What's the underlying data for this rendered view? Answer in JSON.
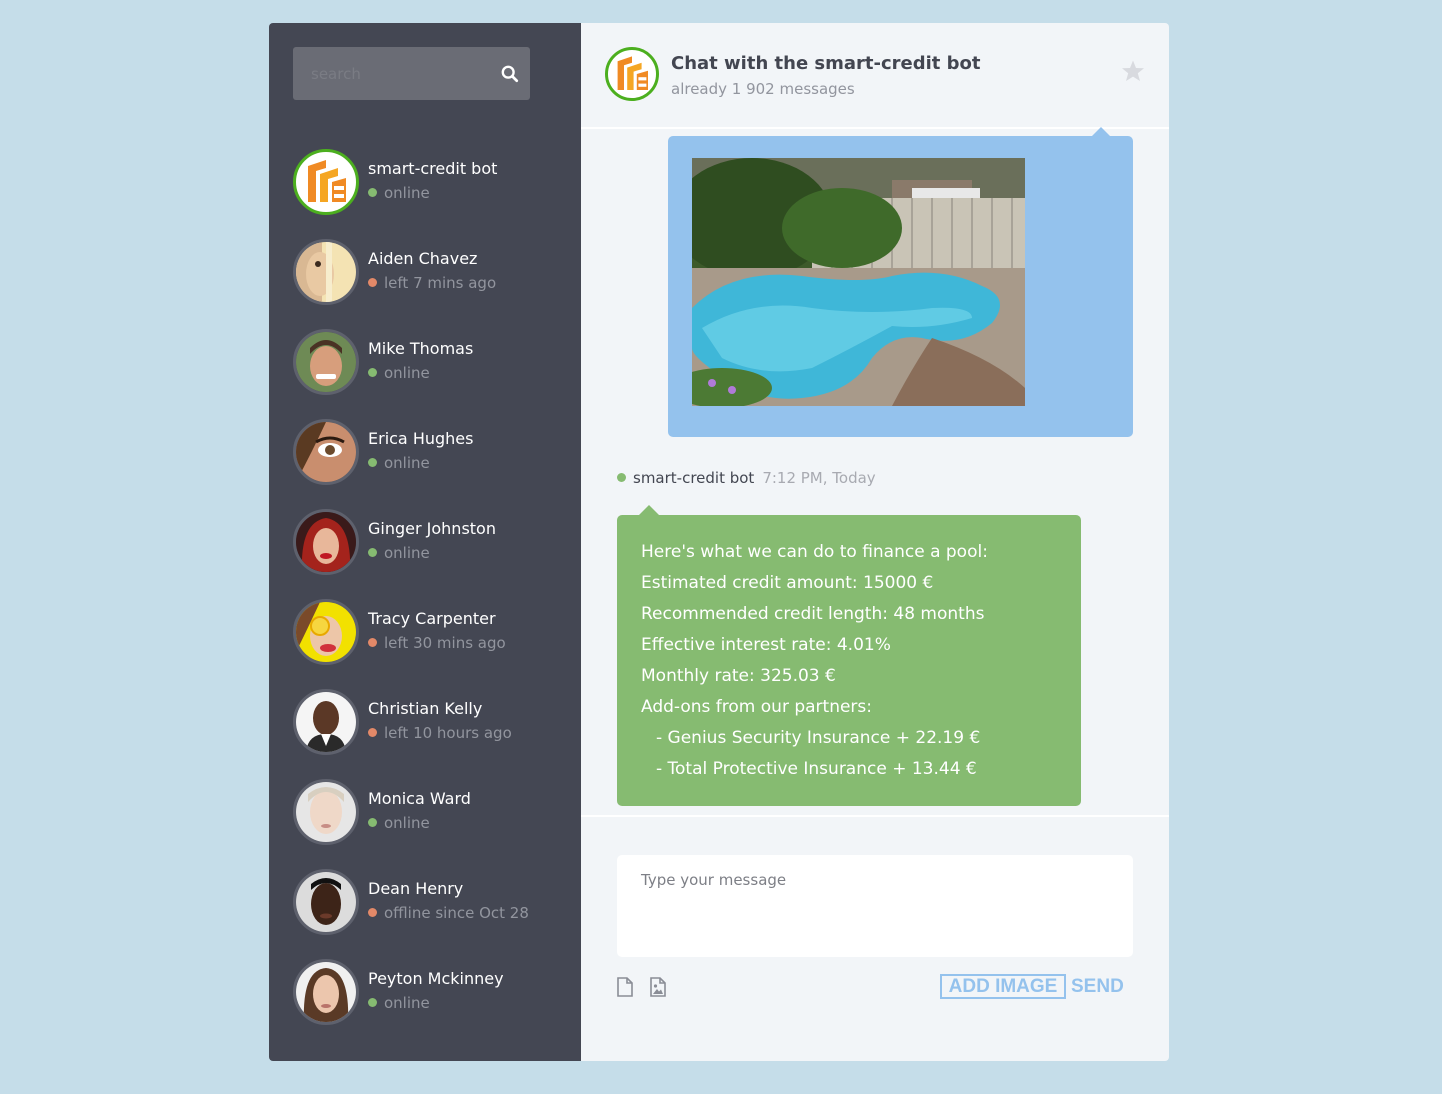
{
  "search": {
    "placeholder": "search",
    "icon": "search-icon"
  },
  "contacts": [
    {
      "name": "smart-credit bot",
      "status": "online",
      "state": "online",
      "avatar": "bot-logo"
    },
    {
      "name": "Aiden Chavez",
      "status": "left 7 mins ago",
      "state": "away",
      "avatar": "photo"
    },
    {
      "name": "Mike Thomas",
      "status": "online",
      "state": "online",
      "avatar": "photo"
    },
    {
      "name": "Erica Hughes",
      "status": "online",
      "state": "online",
      "avatar": "photo"
    },
    {
      "name": "Ginger Johnston",
      "status": "online",
      "state": "online",
      "avatar": "photo"
    },
    {
      "name": "Tracy Carpenter",
      "status": "left 30 mins ago",
      "state": "away",
      "avatar": "photo"
    },
    {
      "name": "Christian Kelly",
      "status": "left 10 hours ago",
      "state": "away",
      "avatar": "photo"
    },
    {
      "name": "Monica Ward",
      "status": "online",
      "state": "online",
      "avatar": "photo"
    },
    {
      "name": "Dean Henry",
      "status": "offline since Oct 28",
      "state": "away",
      "avatar": "photo"
    },
    {
      "name": "Peyton Mckinney",
      "status": "online",
      "state": "online",
      "avatar": "photo"
    }
  ],
  "chat": {
    "title": "Chat with the smart-credit bot",
    "subtitle": "already 1 902 messages",
    "star_icon": "star-icon"
  },
  "messages": {
    "image_message": {
      "content": "swimming-pool-photo"
    },
    "bot_message": {
      "sender": "smart-credit bot",
      "time": "7:12 PM, Today",
      "lines": [
        "Here's what we can do to finance a pool:",
        "Estimated credit amount: 15000 €",
        "Recommended credit length: 48 months",
        "Effective interest rate: 4.01%",
        "Monthly rate: 325.03 €",
        "Add-ons from our partners:",
        "- Genius Security Insurance + 22.19 €",
        "- Total Protective Insurance + 13.44 €"
      ]
    }
  },
  "composer": {
    "placeholder": "Type your message",
    "add_image_label": "ADD IMAGE",
    "send_label": "SEND"
  },
  "colors": {
    "sidebar": "#444753",
    "online": "#86bb71",
    "away": "#e38968",
    "bot_bubble": "#86bb71",
    "user_bubble": "#94c2ed",
    "background": "#c5dde9"
  }
}
